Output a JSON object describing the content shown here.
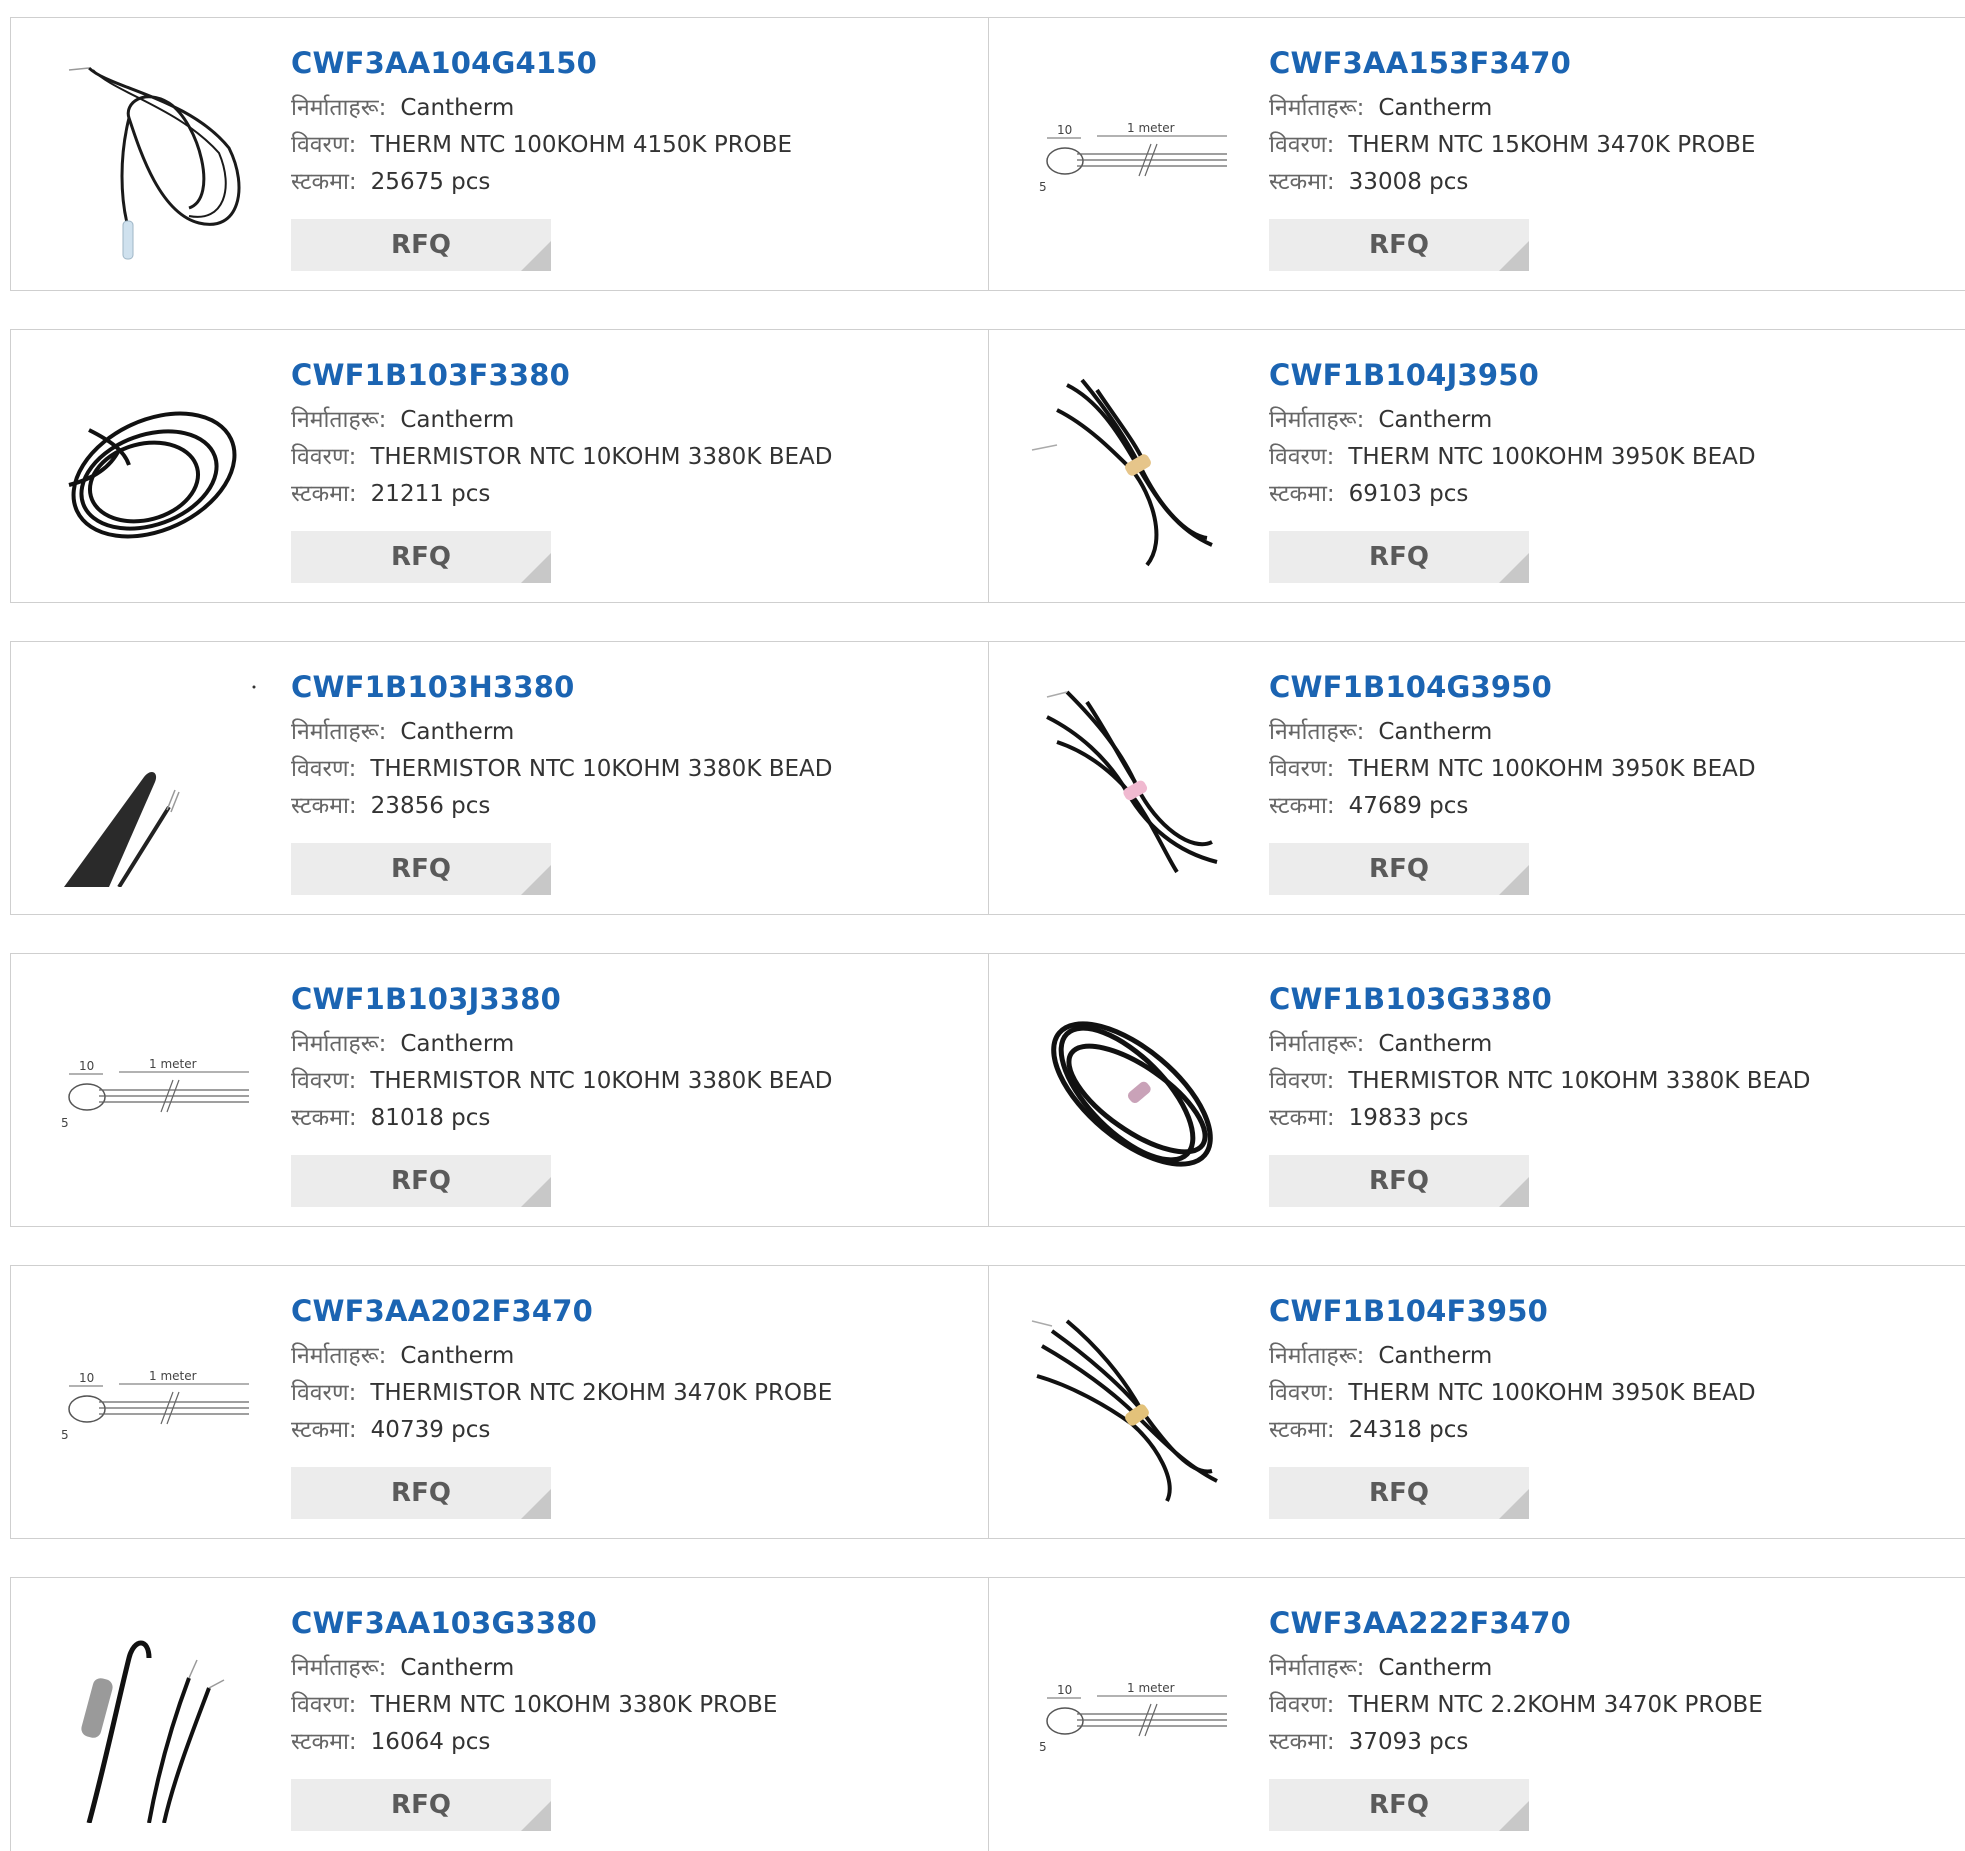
{
  "labels": {
    "manufacturer": "निर्माताहरू:",
    "description": "विवरण:",
    "stock": "स्टकमा:",
    "rfq": "RFQ"
  },
  "products": [
    {
      "part": "CWF3AA104G4150",
      "manufacturer": "Cantherm",
      "description": "THERM NTC 100KOHM 4150K PROBE",
      "stock": "25675 pcs",
      "image": "probe-cable"
    },
    {
      "part": "CWF3AA153F3470",
      "manufacturer": "Cantherm",
      "description": "THERM NTC 15KOHM 3470K PROBE",
      "stock": "33008 pcs",
      "image": "dimension-drawing",
      "drawing": {
        "a": "10",
        "len": "1 meter",
        "b": "5"
      }
    },
    {
      "part": "CWF1B103F3380",
      "manufacturer": "Cantherm",
      "description": "THERMISTOR NTC 10KOHM 3380K BEAD",
      "stock": "21211 pcs",
      "image": "coiled-cable"
    },
    {
      "part": "CWF1B104J3950",
      "manufacturer": "Cantherm",
      "description": "THERM NTC 100KOHM 3950K BEAD",
      "stock": "69103 pcs",
      "image": "bundled-cable"
    },
    {
      "part": "CWF1B103H3380",
      "manufacturer": "Cantherm",
      "description": "THERMISTOR NTC 10KOHM 3380K BEAD",
      "stock": "23856 pcs",
      "image": "bead-closeup"
    },
    {
      "part": "CWF1B104G3950",
      "manufacturer": "Cantherm",
      "description": "THERM NTC 100KOHM 3950K BEAD",
      "stock": "47689 pcs",
      "image": "bundled-cable-pink"
    },
    {
      "part": "CWF1B103J3380",
      "manufacturer": "Cantherm",
      "description": "THERMISTOR NTC 10KOHM 3380K BEAD",
      "stock": "81018 pcs",
      "image": "dimension-drawing",
      "drawing": {
        "a": "10",
        "len": "1 meter",
        "b": "5"
      }
    },
    {
      "part": "CWF1B103G3380",
      "manufacturer": "Cantherm",
      "description": "THERMISTOR NTC 10KOHM 3380K BEAD",
      "stock": "19833 pcs",
      "image": "bundled-cable-dark"
    },
    {
      "part": "CWF3AA202F3470",
      "manufacturer": "Cantherm",
      "description": "THERMISTOR NTC 2KOHM 3470K PROBE",
      "stock": "40739 pcs",
      "image": "dimension-drawing",
      "drawing": {
        "a": "10",
        "len": "1 meter",
        "b": "5"
      }
    },
    {
      "part": "CWF1B104F3950",
      "manufacturer": "Cantherm",
      "description": "THERM NTC 100KOHM 3950K BEAD",
      "stock": "24318 pcs",
      "image": "bundled-cable"
    },
    {
      "part": "CWF3AA103G3380",
      "manufacturer": "Cantherm",
      "description": "THERM NTC 10KOHM 3380K PROBE",
      "stock": "16064 pcs",
      "image": "probe-closeup"
    },
    {
      "part": "CWF3AA222F3470",
      "manufacturer": "Cantherm",
      "description": "THERM NTC 2.2KOHM 3470K PROBE",
      "stock": "37093 pcs",
      "image": "dimension-drawing",
      "drawing": {
        "a": "10",
        "len": "1 meter",
        "b": "5"
      }
    }
  ],
  "colors": {
    "link": "#1b64b2",
    "border": "#cfcfcf",
    "button": "#ececec"
  }
}
